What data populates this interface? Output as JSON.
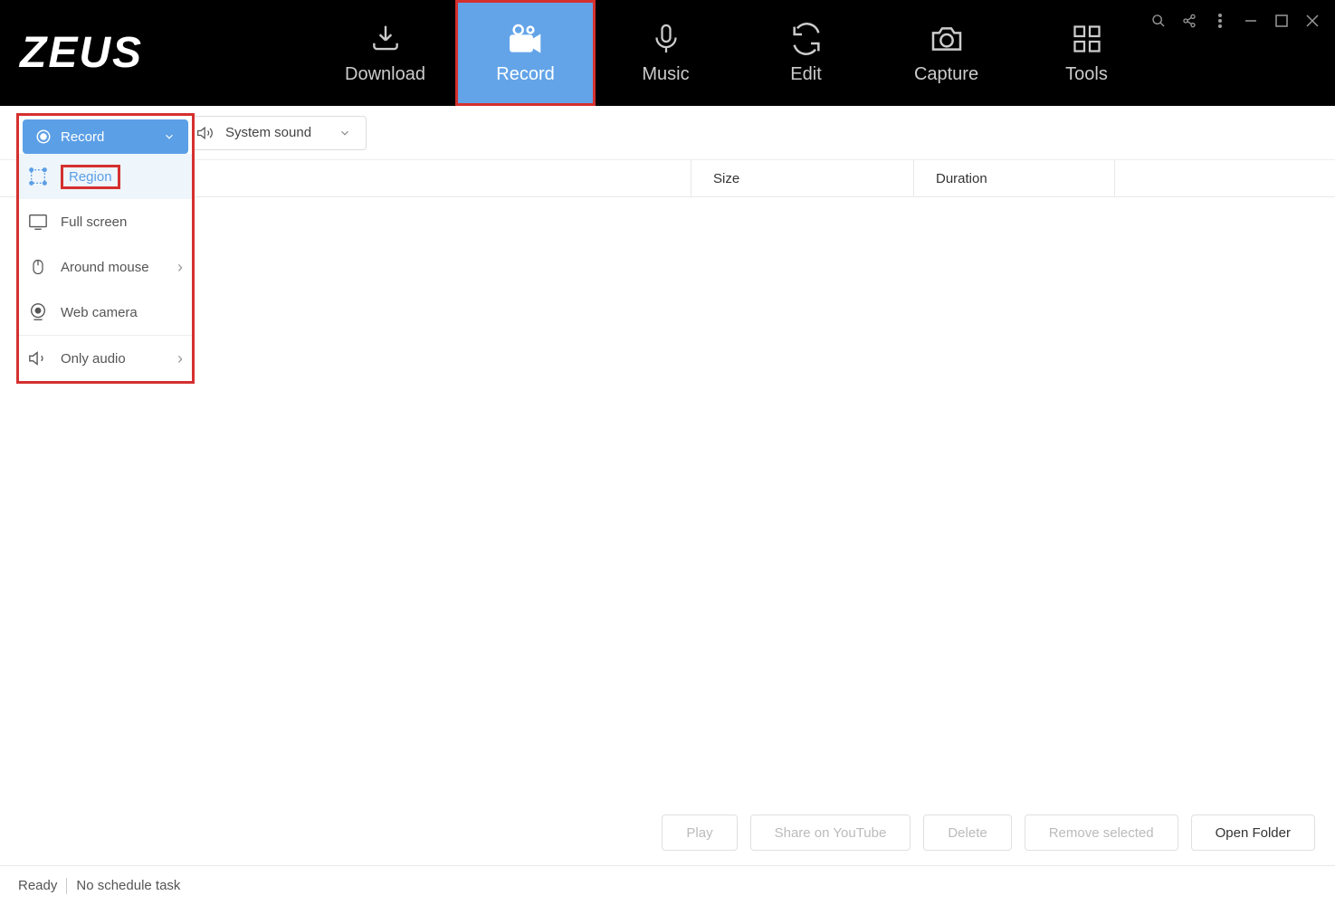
{
  "app_name": "ZEUS",
  "nav": {
    "download": "Download",
    "record": "Record",
    "music": "Music",
    "edit": "Edit",
    "capture": "Capture",
    "tools": "Tools"
  },
  "toolbar": {
    "record_label": "Record",
    "sound_label": "System sound"
  },
  "dropdown": {
    "region": "Region",
    "full_screen": "Full screen",
    "around_mouse": "Around mouse",
    "web_camera": "Web camera",
    "only_audio": "Only audio"
  },
  "table": {
    "size": "Size",
    "duration": "Duration"
  },
  "buttons": {
    "play": "Play",
    "share": "Share on YouTube",
    "delete": "Delete",
    "remove_selected": "Remove selected",
    "open_folder": "Open Folder"
  },
  "status": {
    "ready": "Ready",
    "schedule": "No schedule task"
  }
}
